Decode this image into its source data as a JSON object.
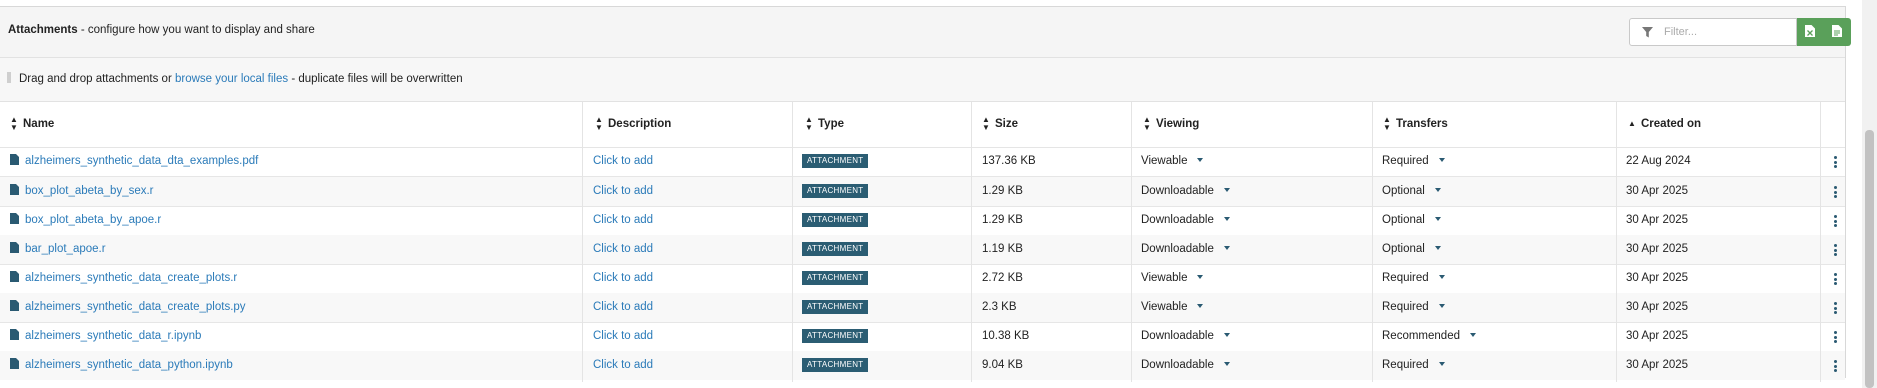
{
  "header": {
    "title_bold": "Attachments",
    "title_rest": " - configure how you want to display and share",
    "filter_placeholder": "Filter..."
  },
  "dropzone": {
    "text_before": "Drag and drop attachments or ",
    "link_text": "browse your local files",
    "text_after": " - duplicate files will be overwritten"
  },
  "columns": {
    "name": "Name",
    "description": "Description",
    "type": "Type",
    "size": "Size",
    "viewing": "Viewing",
    "transfers": "Transfers",
    "created": "Created on"
  },
  "rows": [
    {
      "name": "alzheimers_synthetic_data_dta_examples.pdf",
      "description": "Click to add",
      "type": "ATTACHMENT",
      "size": "137.36 KB",
      "viewing": "Viewable",
      "transfers": "Required",
      "created": "22 Aug 2024"
    },
    {
      "name": "box_plot_abeta_by_sex.r",
      "description": "Click to add",
      "type": "ATTACHMENT",
      "size": "1.29 KB",
      "viewing": "Downloadable",
      "transfers": "Optional",
      "created": "30 Apr 2025"
    },
    {
      "name": "box_plot_abeta_by_apoe.r",
      "description": "Click to add",
      "type": "ATTACHMENT",
      "size": "1.29 KB",
      "viewing": "Downloadable",
      "transfers": "Optional",
      "created": "30 Apr 2025"
    },
    {
      "name": "bar_plot_apoe.r",
      "description": "Click to add",
      "type": "ATTACHMENT",
      "size": "1.19 KB",
      "viewing": "Downloadable",
      "transfers": "Optional",
      "created": "30 Apr 2025"
    },
    {
      "name": "alzheimers_synthetic_data_create_plots.r",
      "description": "Click to add",
      "type": "ATTACHMENT",
      "size": "2.72 KB",
      "viewing": "Viewable",
      "transfers": "Required",
      "created": "30 Apr 2025"
    },
    {
      "name": "alzheimers_synthetic_data_create_plots.py",
      "description": "Click to add",
      "type": "ATTACHMENT",
      "size": "2.3 KB",
      "viewing": "Viewable",
      "transfers": "Required",
      "created": "30 Apr 2025"
    },
    {
      "name": "alzheimers_synthetic_data_r.ipynb",
      "description": "Click to add",
      "type": "ATTACHMENT",
      "size": "10.38 KB",
      "viewing": "Downloadable",
      "transfers": "Recommended",
      "created": "30 Apr 2025"
    },
    {
      "name": "alzheimers_synthetic_data_python.ipynb",
      "description": "Click to add",
      "type": "ATTACHMENT",
      "size": "9.04 KB",
      "viewing": "Downloadable",
      "transfers": "Required",
      "created": "30 Apr 2025"
    }
  ],
  "colors": {
    "link": "#2b7bb9",
    "badge": "#2b5d73",
    "button_green": "#5aa05a"
  }
}
